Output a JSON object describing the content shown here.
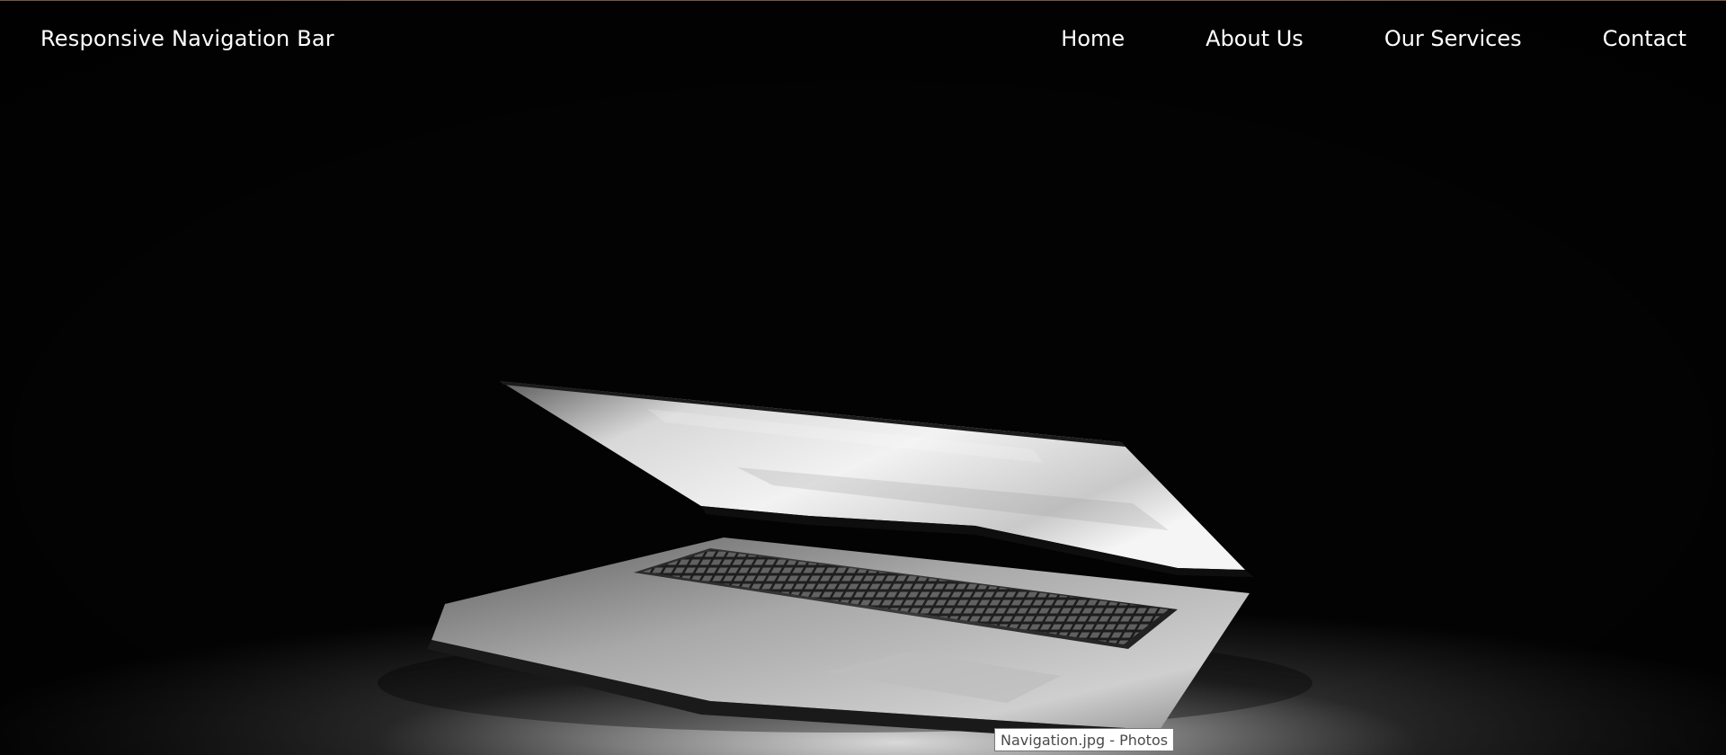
{
  "navbar": {
    "brand": "Responsive Navigation Bar",
    "links": [
      {
        "label": "Home"
      },
      {
        "label": "About Us"
      },
      {
        "label": "Our Services"
      },
      {
        "label": "Contact"
      }
    ]
  },
  "hero": {
    "image_subject": "laptop"
  },
  "tooltip": {
    "text": "Navigation.jpg - Photos"
  },
  "colors": {
    "background": "#030303",
    "nav_text": "#ffffff",
    "tooltip_bg": "#ffffff",
    "tooltip_text": "#4a4a4a"
  }
}
